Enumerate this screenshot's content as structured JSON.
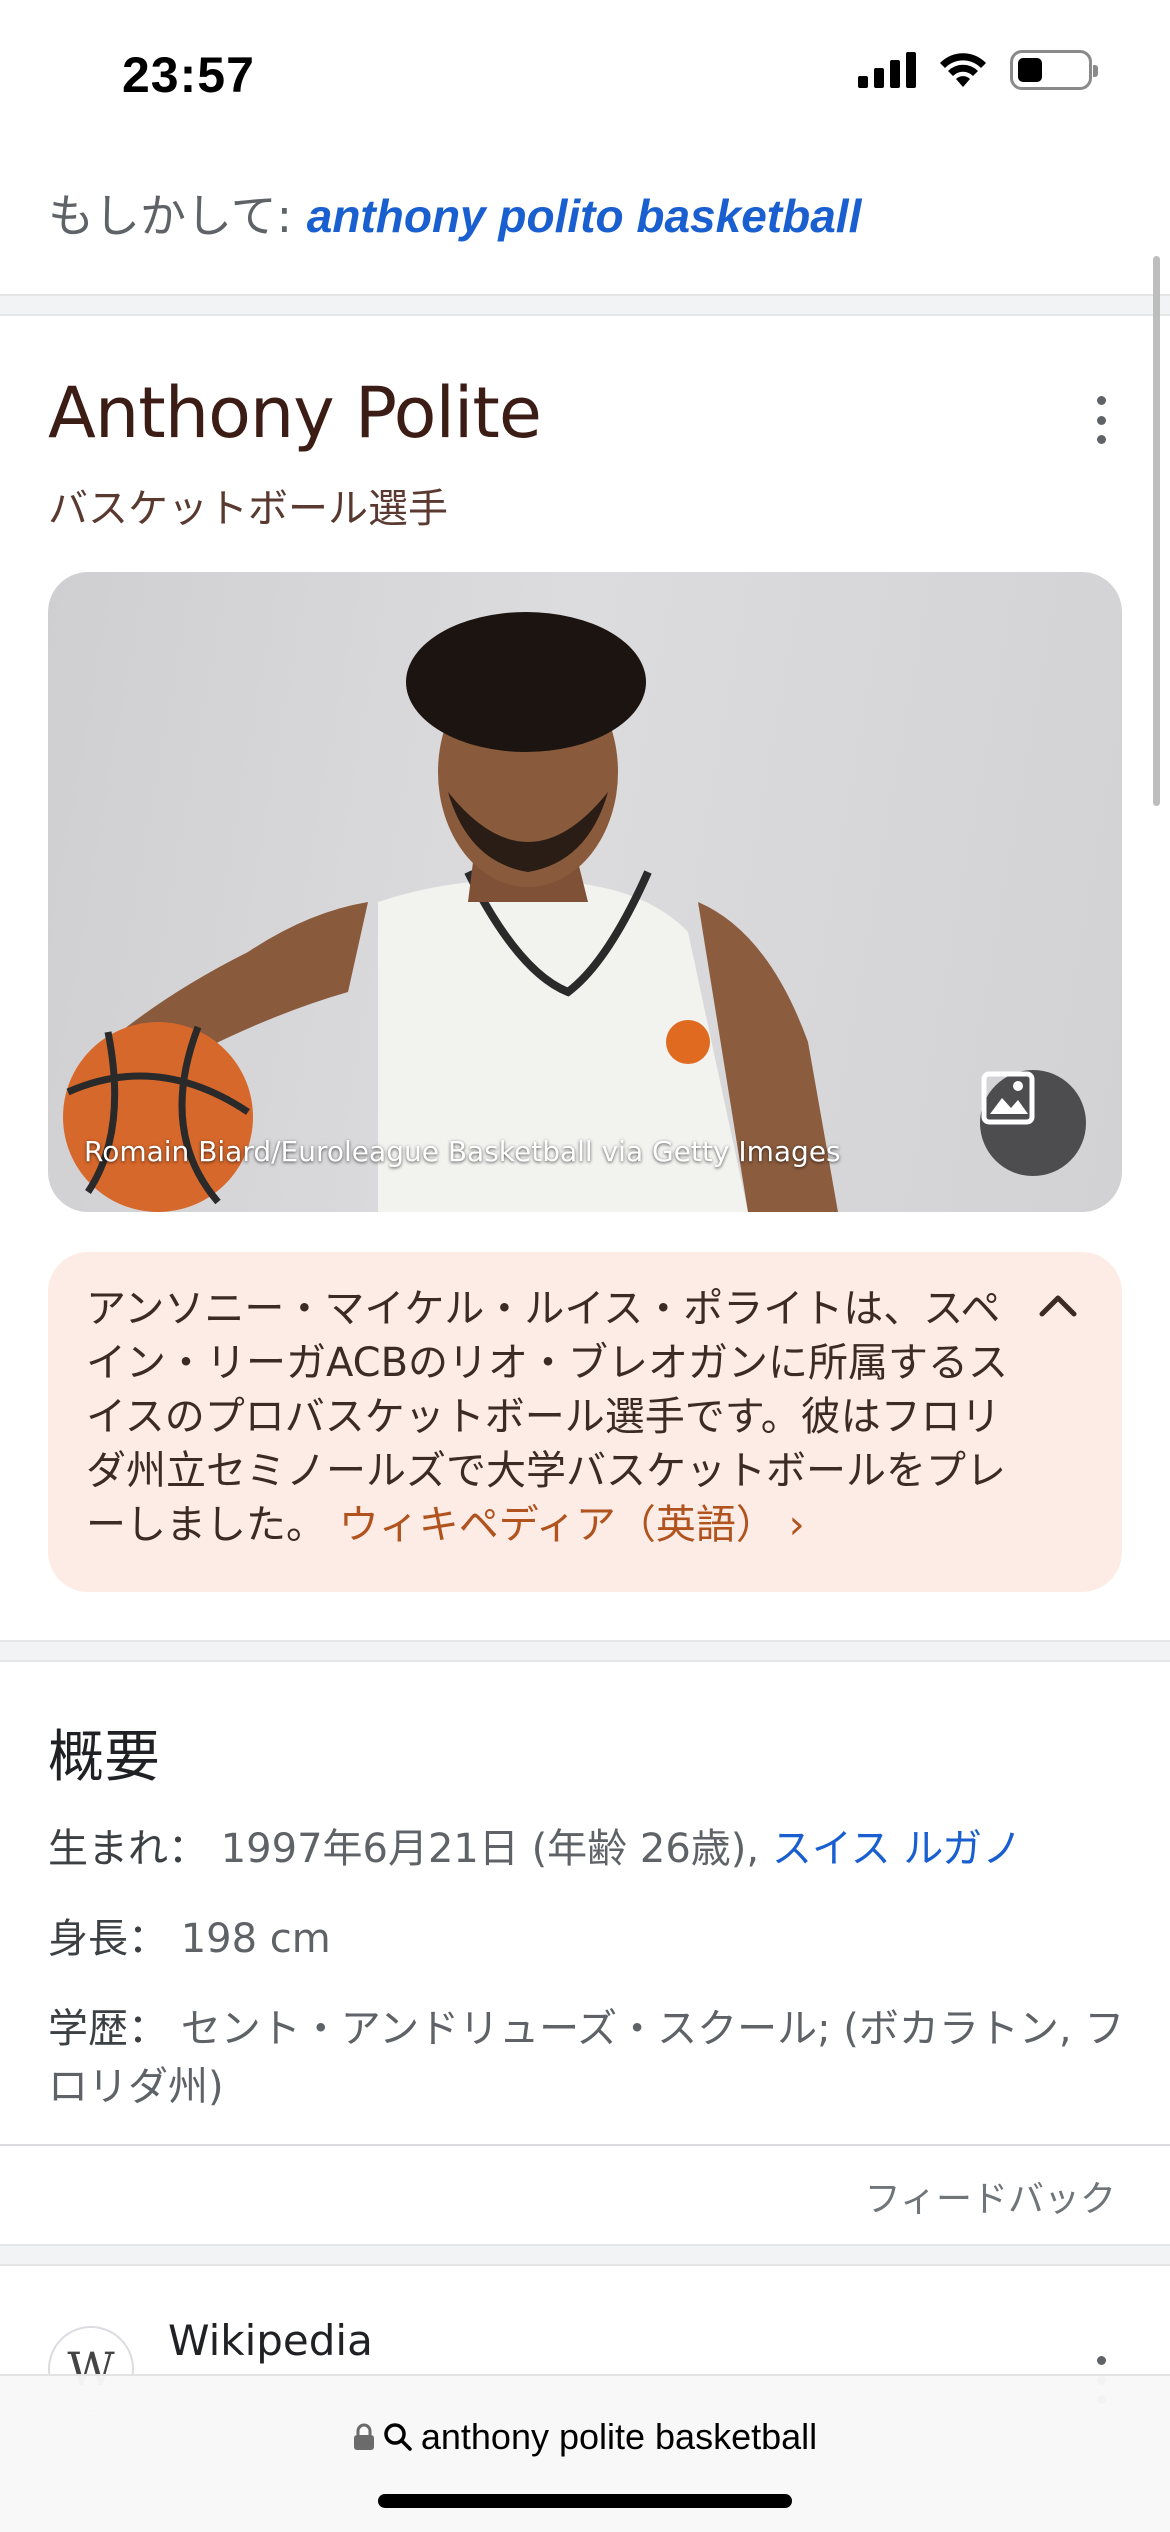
{
  "status_bar": {
    "time": "23:57",
    "battery_level": 0.35
  },
  "did_you_mean": {
    "prefix": "もしかして:",
    "suggestion": "anthony polito basketball"
  },
  "knowledge_panel": {
    "title": "Anthony Polite",
    "subtitle": "バスケットボール選手",
    "photo_credit": "Romain Biard/Euroleague Basketball via Getty Images",
    "description": "アンソニー・マイケル・ルイス・ポライトは、スペイン・リーガACBのリオ・ブレオガンに所属するスイスのプロバスケットボール選手です。彼はフロリダ州立セミノールズで大学バスケットボールをプレーしました。",
    "description_link": "ウィキペディア（英語）",
    "description_link_arrow": "›"
  },
  "overview": {
    "title": "概要",
    "born_label": "生まれ：",
    "born_value": "1997年6月21日 (年齢 26歳),",
    "born_place": "スイス ルガノ",
    "height_label": "身長：",
    "height_value": "198 cm",
    "education_label": "学歴：",
    "education_value": "セント・アンドリューズ・スクール; (ボカラトン, フロリダ州)",
    "feedback": "フィードバック"
  },
  "result": {
    "icon_letter": "W",
    "source_title": "Wikipedia"
  },
  "browser": {
    "address": "anthony polite basketball"
  },
  "colors": {
    "link_blue": "#1a5fd0",
    "title_brown": "#3c1d16",
    "desc_bg": "#fdece6",
    "desc_link": "#b0531e"
  },
  "icons": [
    "cellular-signal-icon",
    "wifi-icon",
    "battery-icon",
    "more-vert-icon",
    "image-icon",
    "chevron-up-icon",
    "lock-icon",
    "search-icon"
  ]
}
